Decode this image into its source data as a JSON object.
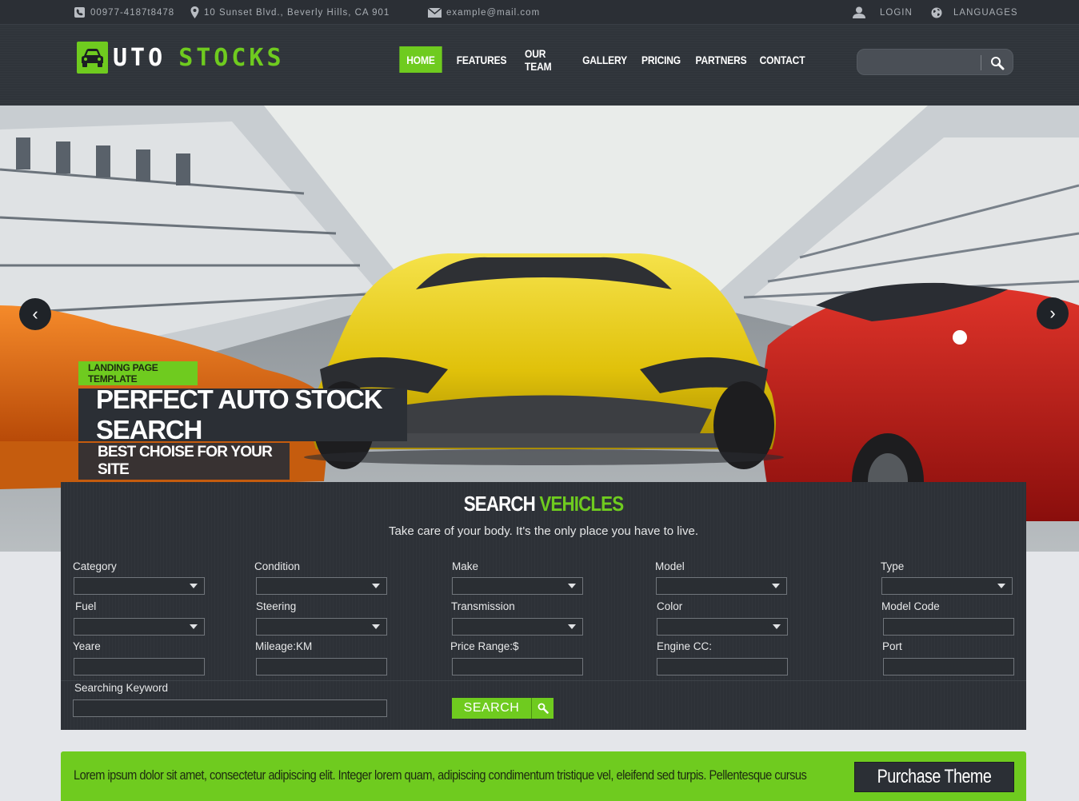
{
  "topbar": {
    "phone": "00977-4187t8478",
    "address": "10 Sunset Blvd., Beverly Hills, CA 901",
    "email": "example@mail.com",
    "login": "LOGIN",
    "languages": "LANGUAGES"
  },
  "brand": {
    "part1": "UTO",
    "part2": "STOCKS"
  },
  "nav": {
    "items": [
      "HOME",
      "FEATURES",
      "OUR TEAM",
      "GALLERY",
      "PRICING",
      "PARTNERS",
      "CONTACT"
    ],
    "active": "HOME"
  },
  "header_search": {
    "value": ""
  },
  "hero": {
    "tag": "LANDING PAGE TEMPLATE",
    "title": "PERFECT AUTO STOCK SEARCH",
    "subtitle": "BEST CHOISE FOR YOUR SITE",
    "prev_symbol": "‹",
    "next_symbol": "›"
  },
  "search_panel": {
    "title_part1": "SEARCH",
    "title_part2": "VEHICLES",
    "subtitle": "Take care of your body. It's the only place you have to live.",
    "fields": [
      {
        "label": "Category",
        "kind": "select",
        "value": ""
      },
      {
        "label": "Condition",
        "kind": "select",
        "value": ""
      },
      {
        "label": "Make",
        "kind": "select",
        "value": ""
      },
      {
        "label": "Model",
        "kind": "select",
        "value": ""
      },
      {
        "label": "Type",
        "kind": "select",
        "value": ""
      },
      {
        "label": "Fuel",
        "kind": "select",
        "value": ""
      },
      {
        "label": "Steering",
        "kind": "select",
        "value": ""
      },
      {
        "label": "Transmission",
        "kind": "select",
        "value": ""
      },
      {
        "label": "Color",
        "kind": "select",
        "value": ""
      },
      {
        "label": "Model Code",
        "kind": "input",
        "value": ""
      },
      {
        "label": "Yeare",
        "kind": "input",
        "value": ""
      },
      {
        "label": "Mileage:KM",
        "kind": "input",
        "value": ""
      },
      {
        "label": "Price Range:$",
        "kind": "input",
        "value": ""
      },
      {
        "label": "Engine CC:",
        "kind": "input",
        "value": ""
      },
      {
        "label": "Port",
        "kind": "input",
        "value": ""
      }
    ],
    "keyword_label": "Searching Keyword",
    "keyword_value": "",
    "search_button": "SEARCH"
  },
  "promo": {
    "text": "Lorem ipsum dolor sit amet, consectetur adipiscing elit. Integer lorem quam, adipiscing condimentum tristique vel, eleifend sed turpis. Pellentesque cursus",
    "button": "Purchase Theme"
  },
  "colors": {
    "accent": "#6fcb1f",
    "dark": "#2b2f35",
    "panel": "#2d3137"
  },
  "icons": [
    "phone-icon",
    "map-pin-icon",
    "mail-icon",
    "user-icon",
    "globe-icon",
    "car-icon",
    "search-icon"
  ]
}
